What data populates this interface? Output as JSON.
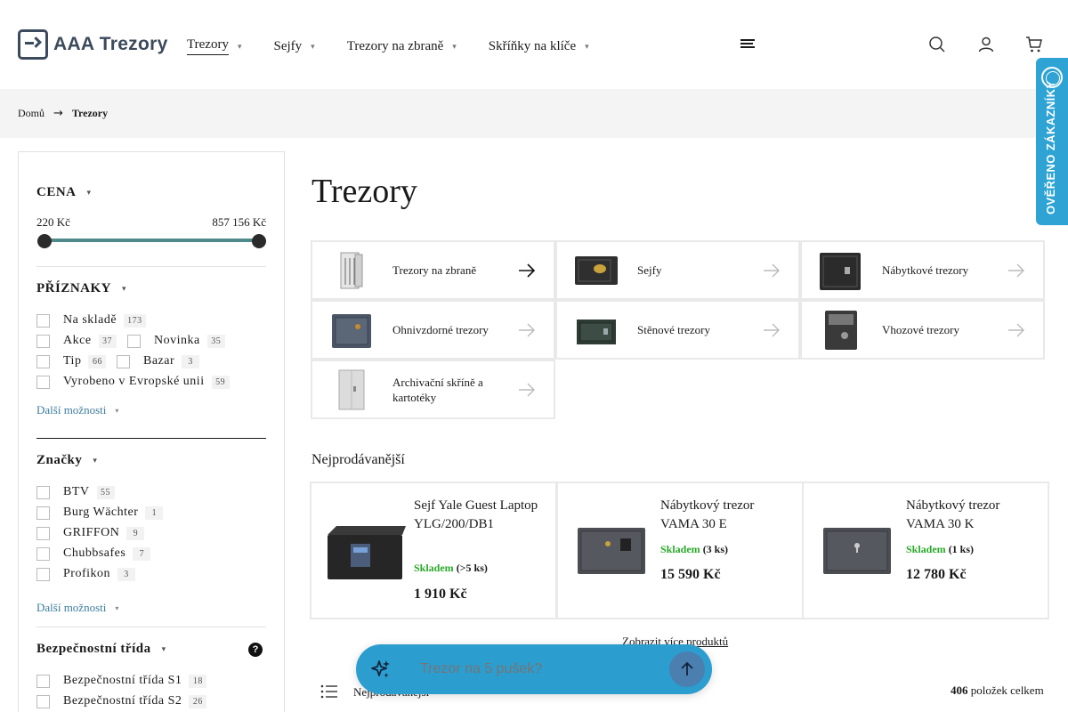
{
  "header": {
    "logo_text": "AAA Trezory",
    "nav": [
      {
        "label": "Trezory",
        "active": true
      },
      {
        "label": "Sejfy"
      },
      {
        "label": "Trezory na zbraně"
      },
      {
        "label": "Skříňky na klíče"
      }
    ],
    "icons": [
      "menu-icon",
      "search-icon",
      "user-icon",
      "cart-icon"
    ],
    "chevron": "▾"
  },
  "breadcrumb": {
    "home": "Domů",
    "current": "Trezory"
  },
  "verified_badge": "OVĚŘENO ZÁKAZNÍKY",
  "filters": {
    "price": {
      "title": "CENA",
      "min": "220 Kč",
      "max": "857 156 Kč"
    },
    "flags": {
      "title": "PŘÍZNAKY",
      "items": [
        {
          "label": "Na skladě",
          "count": "173"
        },
        {
          "label": "Akce",
          "count": "37"
        },
        {
          "label": "Novinka",
          "count": "35"
        },
        {
          "label": "Tip",
          "count": "66"
        },
        {
          "label": "Bazar",
          "count": "3"
        },
        {
          "label": "Vyrobeno v Evropské unii",
          "count": "59"
        }
      ],
      "more": "Další možnosti"
    },
    "brands": {
      "title": "Značky",
      "items": [
        {
          "label": "BTV",
          "count": "55"
        },
        {
          "label": "Burg Wächter",
          "count": "1"
        },
        {
          "label": "GRIFFON",
          "count": "9"
        },
        {
          "label": "Chubbsafes",
          "count": "7"
        },
        {
          "label": "Profikon",
          "count": "3"
        }
      ],
      "more": "Další možnosti"
    },
    "security": {
      "title": "Bezpečnostní třída",
      "help": "?",
      "items": [
        {
          "label": "Bezpečnostní třída S1",
          "count": "18"
        },
        {
          "label": "Bezpečnostní třída S2",
          "count": "26"
        }
      ]
    }
  },
  "main": {
    "title": "Trezory",
    "categories": [
      {
        "label": "Trezory na zbraně"
      },
      {
        "label": "Sejfy"
      },
      {
        "label": "Nábytkové trezory"
      },
      {
        "label": "Ohnivzdorné trezory"
      },
      {
        "label": "Stěnové trezory"
      },
      {
        "label": "Vhozové trezory"
      },
      {
        "label": "Archivační skříně a kartotéky"
      }
    ],
    "bestsellers_title": "Nejprodávanější",
    "products": [
      {
        "name": "Sejf Yale Guest Laptop YLG/200/DB1",
        "stock": "Skladem",
        "qty": "(>5 ks)",
        "price": "1 910 Kč"
      },
      {
        "name": "Nábytkový trezor VAMA 30 E",
        "stock": "Skladem",
        "qty": "(3 ks)",
        "price": "15 590 Kč"
      },
      {
        "name": "Nábytkový trezor VAMA 30 K",
        "stock": "Skladem",
        "qty": "(1 ks)",
        "price": "12 780 Kč"
      }
    ],
    "more_products": "Zobrazit více produktů",
    "sort_label": "Nejprodávanější",
    "total_count": "406",
    "total_suffix": "položek celkem"
  },
  "ai_search": {
    "placeholder": "Trezor na 5 pušek?"
  },
  "colors": {
    "accent": "#2c9dcf",
    "slider": "#4f8a8b",
    "stock": "#29a829",
    "link": "#3d7c9e"
  }
}
